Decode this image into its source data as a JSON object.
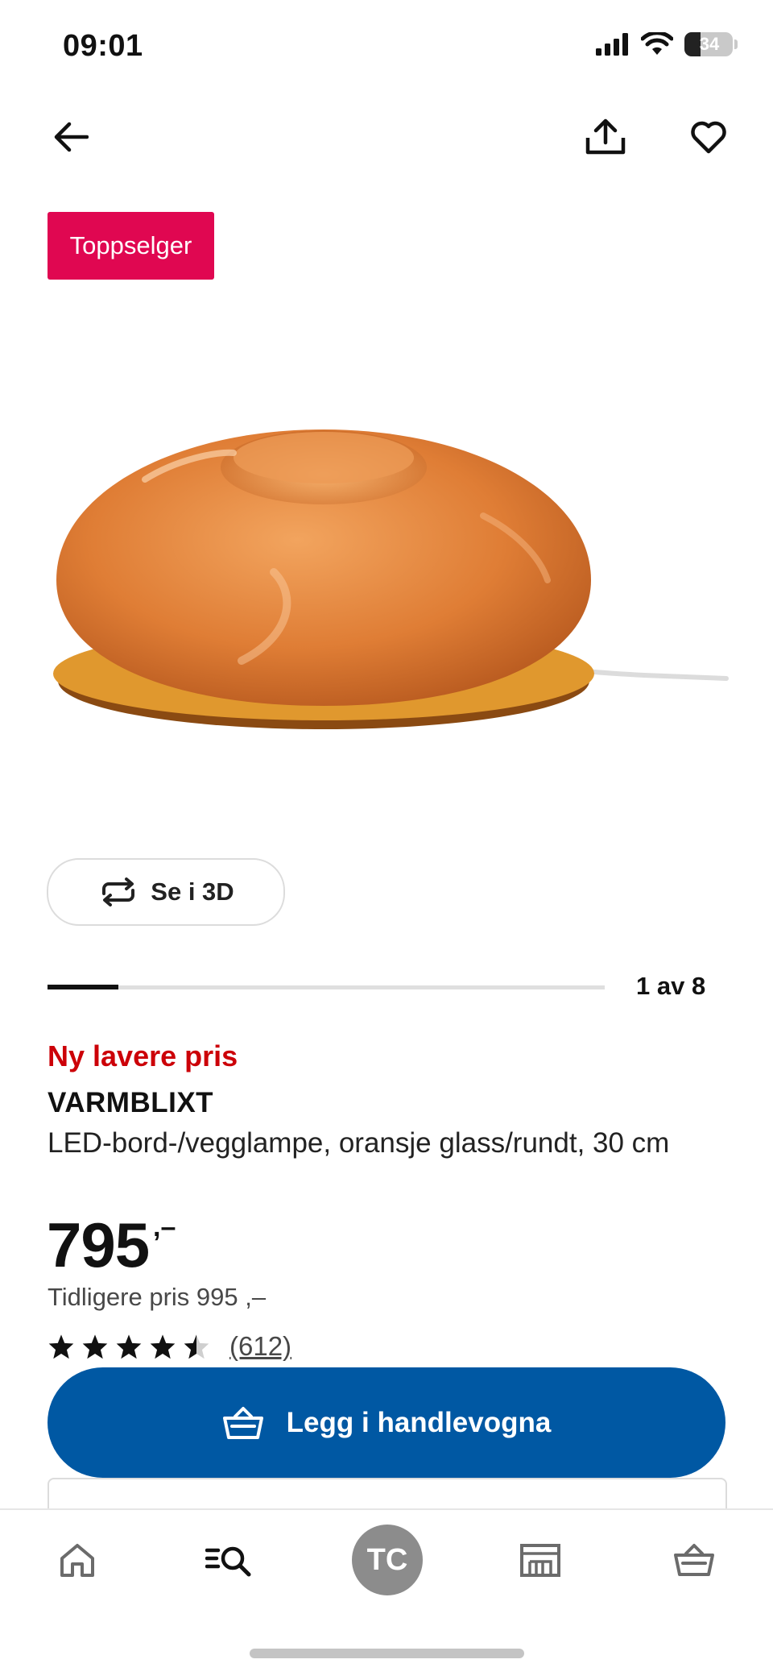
{
  "status_bar": {
    "time": "09:01",
    "battery": "34",
    "icons": [
      "cellular-signal-icon",
      "wifi-icon",
      "battery-icon"
    ]
  },
  "top_nav": {
    "icons": [
      "back-arrow-icon",
      "share-icon",
      "heart-icon"
    ]
  },
  "badge": {
    "label": "Toppselger",
    "color": "#e00751"
  },
  "view_3d": {
    "label": "Se i 3D",
    "icon": "rotate-3d-icon"
  },
  "carousel": {
    "position_text": "1 av 8",
    "current": 1,
    "total": 8
  },
  "product": {
    "promo_label": "Ny lavere pris",
    "name": "VARMBLIXT",
    "description": "LED-bord-/vegglampe, oransje glass/rundt, 30 cm",
    "price": "795",
    "price_suffix": ",–",
    "previous_price": "Tidligere pris 995 ,–",
    "rating": {
      "value": 4.5,
      "max": 5,
      "count_text": "(612)"
    }
  },
  "cart_button": {
    "label": "Legg i handlevogna",
    "icon": "shopping-basket-icon",
    "color": "#0058a3"
  },
  "tab_bar": {
    "items": [
      "home-icon",
      "search-icon",
      "profile-avatar",
      "store-icon",
      "basket-icon"
    ],
    "avatar_initials": "TC"
  },
  "colors": {
    "promo": "#cc0008",
    "accent": "#0058a3",
    "badge": "#e00751"
  }
}
